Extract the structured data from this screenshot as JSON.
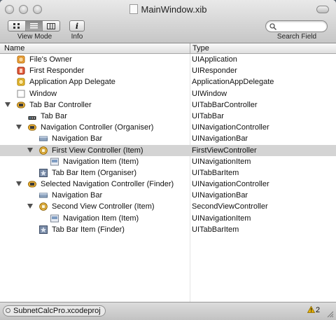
{
  "window": {
    "title": "MainWindow.xib"
  },
  "toolbar": {
    "view_mode_label": "View Mode",
    "info_label": "Info",
    "info_glyph": "i",
    "search_label": "Search Field",
    "search_placeholder": ""
  },
  "columns": {
    "name": "Name",
    "type": "Type"
  },
  "rows": [
    {
      "name": "File's Owner",
      "type": "UIApplication",
      "depth": 0,
      "disclosure": "none",
      "icon": "cube-orange-icon"
    },
    {
      "name": "First Responder",
      "type": "UIResponder",
      "depth": 0,
      "disclosure": "none",
      "icon": "responder-red-icon"
    },
    {
      "name": "Application App Delegate",
      "type": "ApplicationAppDelegate",
      "depth": 0,
      "disclosure": "none",
      "icon": "cube-yellow-icon"
    },
    {
      "name": "Window",
      "type": "UIWindow",
      "depth": 0,
      "disclosure": "none",
      "icon": "window-icon"
    },
    {
      "name": "Tab Bar Controller",
      "type": "UITabBarController",
      "depth": 0,
      "disclosure": "open",
      "icon": "controller-icon"
    },
    {
      "name": "Tab Bar",
      "type": "UITabBar",
      "depth": 1,
      "disclosure": "none",
      "icon": "tab-bar-icon"
    },
    {
      "name": "Navigation Controller (Organiser)",
      "type": "UINavigationController",
      "depth": 1,
      "disclosure": "open",
      "icon": "controller-icon"
    },
    {
      "name": "Navigation Bar",
      "type": "UINavigationBar",
      "depth": 2,
      "disclosure": "none",
      "icon": "navigation-bar-icon"
    },
    {
      "name": "First View Controller (Item)",
      "type": "FirstViewController",
      "depth": 2,
      "disclosure": "open",
      "icon": "view-controller-icon",
      "selected": true
    },
    {
      "name": "Navigation Item (Item)",
      "type": "UINavigationItem",
      "depth": 3,
      "disclosure": "none",
      "icon": "navigation-item-icon"
    },
    {
      "name": "Tab Bar Item (Organiser)",
      "type": "UITabBarItem",
      "depth": 2,
      "disclosure": "none",
      "icon": "tab-bar-item-icon"
    },
    {
      "name": "Selected Navigation Controller (Finder)",
      "type": "UINavigationController",
      "depth": 1,
      "disclosure": "open",
      "icon": "controller-icon"
    },
    {
      "name": "Navigation Bar",
      "type": "UINavigationBar",
      "depth": 2,
      "disclosure": "none",
      "icon": "navigation-bar-icon"
    },
    {
      "name": "Second View Controller (Item)",
      "type": "SecondViewController",
      "depth": 2,
      "disclosure": "open",
      "icon": "view-controller-icon"
    },
    {
      "name": "Navigation Item (Item)",
      "type": "UINavigationItem",
      "depth": 3,
      "disclosure": "none",
      "icon": "navigation-item-icon"
    },
    {
      "name": "Tab Bar Item (Finder)",
      "type": "UITabBarItem",
      "depth": 2,
      "disclosure": "none",
      "icon": "tab-bar-item-icon"
    }
  ],
  "status": {
    "project": "SubnetCalcPro.xcodeproj",
    "warning_count": "2"
  },
  "colors": {
    "selected_row": "#d4d4d4",
    "warning": "#e8b100"
  }
}
